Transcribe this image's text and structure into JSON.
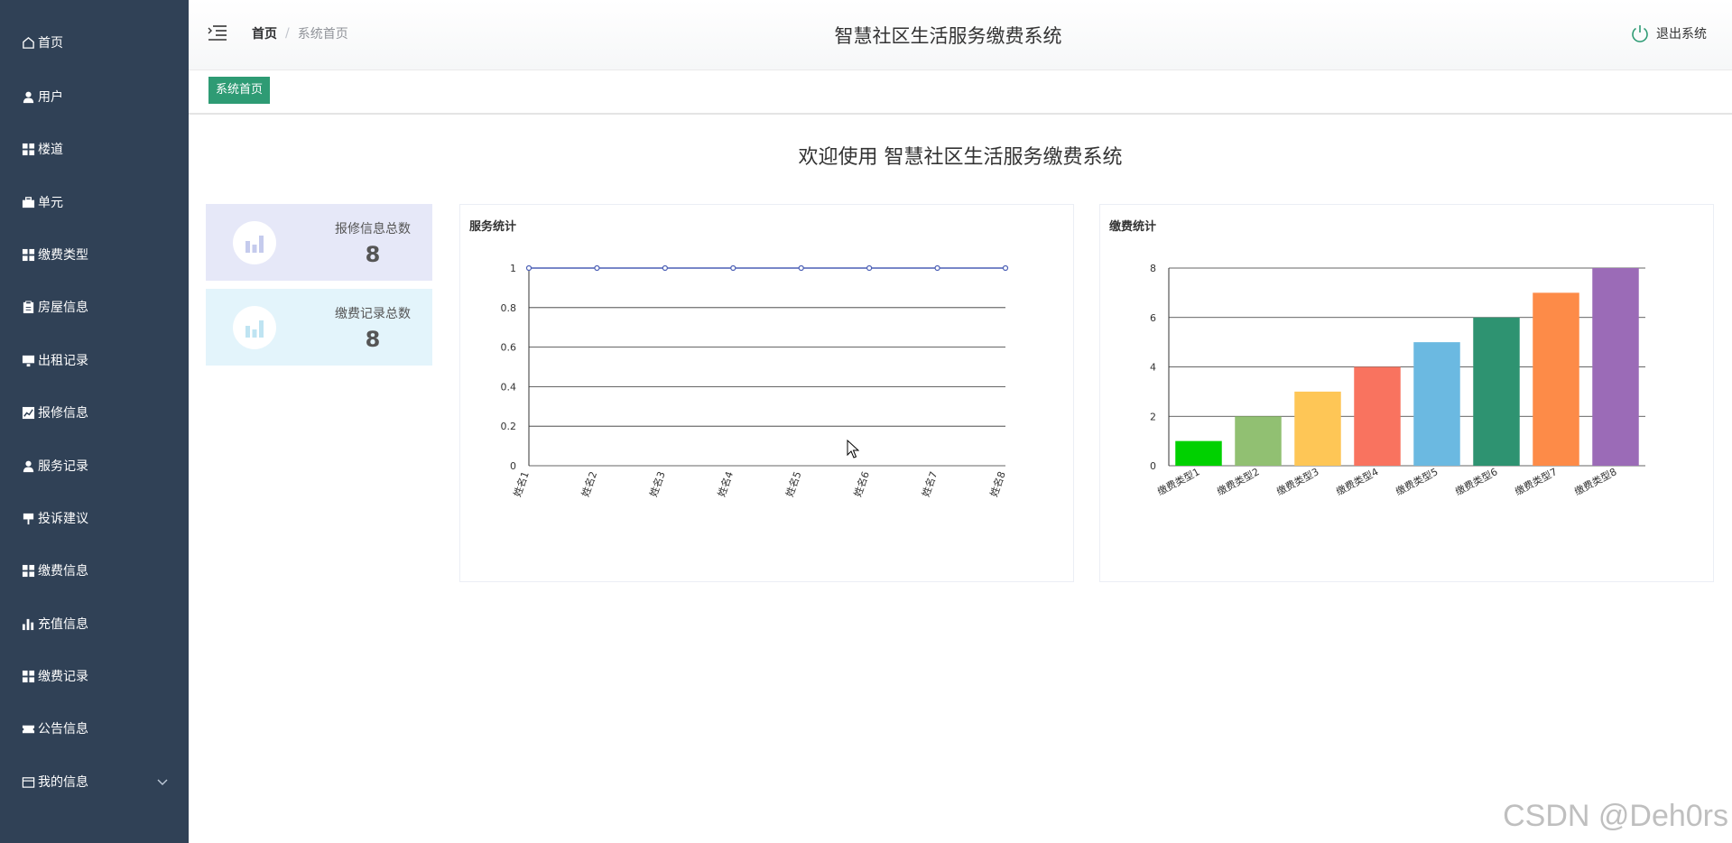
{
  "sidebar": {
    "items": [
      {
        "label": "首页",
        "icon": "home-icon"
      },
      {
        "label": "用户",
        "icon": "user-icon"
      },
      {
        "label": "楼道",
        "icon": "grid-icon"
      },
      {
        "label": "单元",
        "icon": "briefcase-icon"
      },
      {
        "label": "缴费类型",
        "icon": "grid-icon"
      },
      {
        "label": "房屋信息",
        "icon": "clipboard-icon"
      },
      {
        "label": "出租记录",
        "icon": "monitor-icon"
      },
      {
        "label": "报修信息",
        "icon": "chart-line-icon"
      },
      {
        "label": "服务记录",
        "icon": "user-icon"
      },
      {
        "label": "投诉建议",
        "icon": "signpost-icon"
      },
      {
        "label": "缴费信息",
        "icon": "grid-icon"
      },
      {
        "label": "充值信息",
        "icon": "bar-chart-icon"
      },
      {
        "label": "缴费记录",
        "icon": "grid-icon"
      },
      {
        "label": "公告信息",
        "icon": "ticket-icon"
      },
      {
        "label": "我的信息",
        "icon": "wallet-icon"
      }
    ]
  },
  "header": {
    "breadcrumb_home": "首页",
    "breadcrumb_sep": "/",
    "breadcrumb_current": "系统首页",
    "title": "智慧社区生活服务缴费系统",
    "logout_label": "退出系统"
  },
  "tabs": {
    "active": "系统首页"
  },
  "main": {
    "welcome": "欢迎使用 智慧社区生活服务缴费系统",
    "stats": [
      {
        "label": "报修信息总数",
        "value": "8"
      },
      {
        "label": "缴费记录总数",
        "value": "8"
      }
    ]
  },
  "chart_data": [
    {
      "type": "line",
      "title": "服务统计",
      "categories": [
        "姓名1",
        "姓名2",
        "姓名3",
        "姓名4",
        "姓名5",
        "姓名6",
        "姓名7",
        "姓名8"
      ],
      "values": [
        1,
        1,
        1,
        1,
        1,
        1,
        1,
        1
      ],
      "ylim": [
        0,
        1
      ],
      "yticks": [
        "0",
        "0.2",
        "0.4",
        "0.6",
        "0.8",
        "1"
      ],
      "grid": true,
      "color": "#4b5fb5"
    },
    {
      "type": "bar",
      "title": "缴费统计",
      "categories": [
        "缴费类型1",
        "缴费类型2",
        "缴费类型3",
        "缴费类型4",
        "缴费类型5",
        "缴费类型6",
        "缴费类型7",
        "缴费类型8"
      ],
      "values": [
        1,
        2,
        3,
        4,
        5,
        6,
        7,
        8
      ],
      "ylim": [
        0,
        8
      ],
      "yticks": [
        "0",
        "2",
        "4",
        "6",
        "8"
      ],
      "grid": true,
      "colors": [
        "#00d100",
        "#91c072",
        "#fec656",
        "#f9735f",
        "#6bb9e1",
        "#2e9371",
        "#fd8b48",
        "#9b6bb7"
      ]
    }
  ],
  "watermark": "CSDN @Deh0rs"
}
